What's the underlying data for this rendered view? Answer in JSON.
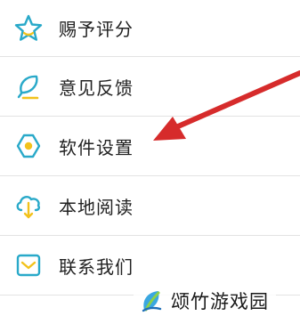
{
  "menu": {
    "items": [
      {
        "label": "赐予评分",
        "icon": "star-icon"
      },
      {
        "label": "意见反馈",
        "icon": "feedback-pen-icon"
      },
      {
        "label": "软件设置",
        "icon": "settings-gear-icon"
      },
      {
        "label": "本地阅读",
        "icon": "cloud-download-icon"
      },
      {
        "label": "联系我们",
        "icon": "envelope-icon"
      }
    ]
  },
  "watermark": {
    "text": "颂竹游戏园"
  },
  "colors": {
    "icon_teal": "#29a9c9",
    "icon_yellow": "#f2c21b",
    "arrow_red": "#d62b2b",
    "divider": "#e3e3e3"
  }
}
